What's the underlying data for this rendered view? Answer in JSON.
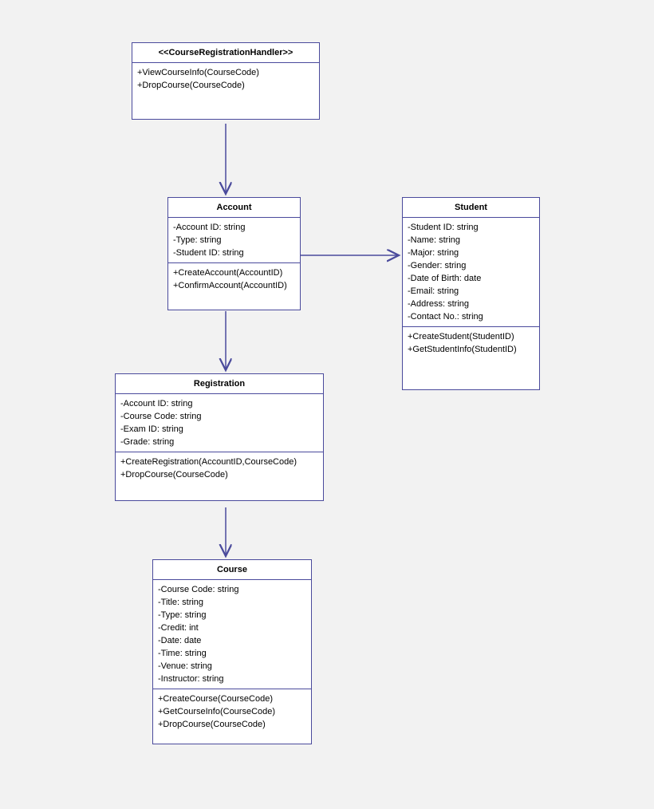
{
  "classes": {
    "handler": {
      "title": "<<CourseRegistrationHandler>>",
      "methods": [
        "+ViewCourseInfo(CourseCode)",
        "+DropCourse(CourseCode)"
      ]
    },
    "account": {
      "title": "Account",
      "attrs": [
        "-Account ID: string",
        "-Type: string",
        "-Student ID: string"
      ],
      "methods": [
        "+CreateAccount(AccountID)",
        "+ConfirmAccount(AccountID)"
      ]
    },
    "student": {
      "title": "Student",
      "attrs": [
        "-Student ID: string",
        "-Name: string",
        "-Major: string",
        "-Gender: string",
        "-Date of Birth: date",
        "-Email: string",
        "-Address: string",
        "-Contact No.: string"
      ],
      "methods": [
        "+CreateStudent(StudentID)",
        "+GetStudentInfo(StudentID)"
      ]
    },
    "registration": {
      "title": "Registration",
      "attrs": [
        "-Account ID: string",
        "-Course Code: string",
        "-Exam ID: string",
        "-Grade: string"
      ],
      "methods": [
        "+CreateRegistration(AccountID,CourseCode)",
        "+DropCourse(CourseCode)"
      ]
    },
    "course": {
      "title": "Course",
      "attrs": [
        "-Course Code: string",
        "-Title: string",
        "-Type: string",
        "-Credit: int",
        "-Date: date",
        "-Time: string",
        "-Venue: string",
        "-Instructor: string"
      ],
      "methods": [
        "+CreateCourse(CourseCode)",
        "+GetCourseInfo(CourseCode)",
        "+DropCourse(CourseCode)"
      ]
    }
  }
}
